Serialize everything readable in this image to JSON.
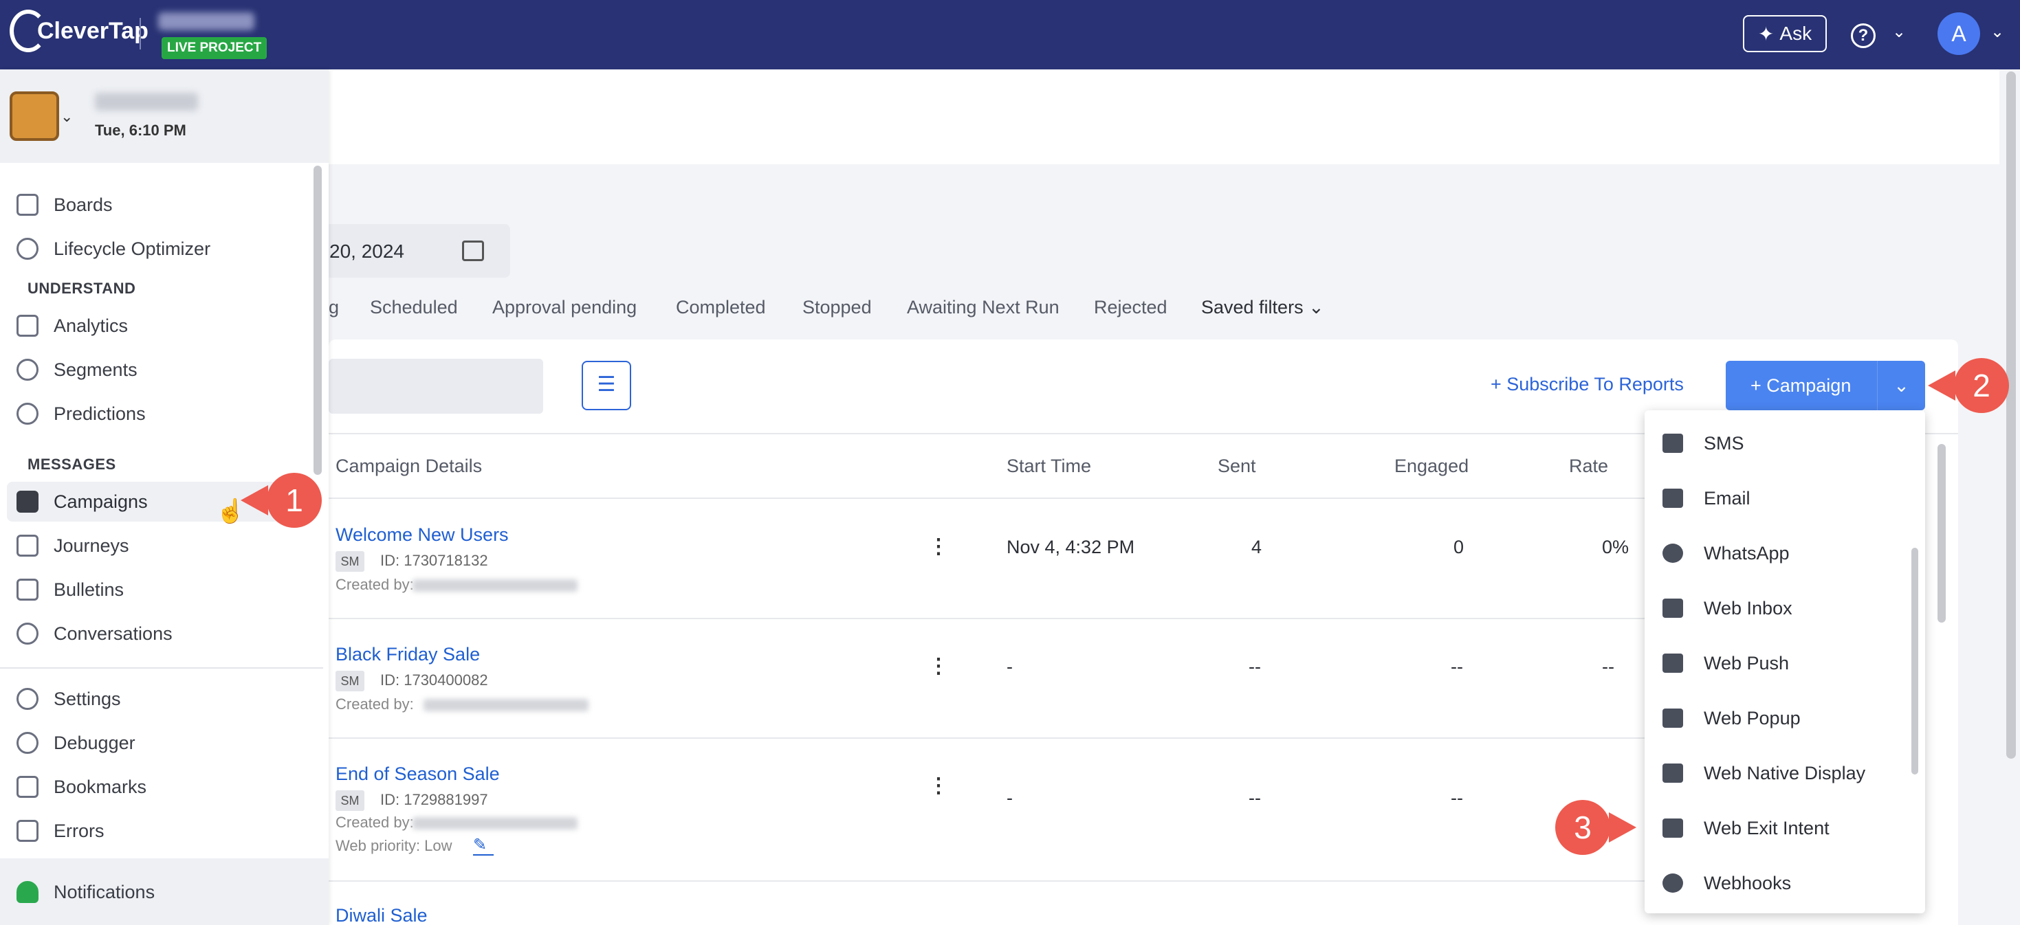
{
  "app": {
    "logo_text": "CleverTap",
    "live_badge": "LIVE PROJECT",
    "ask_label": "Ask",
    "avatar_initial": "A",
    "brand_color": "#283274",
    "accent_color": "#4a84f0"
  },
  "account": {
    "time": "Tue, 6:10 PM"
  },
  "sidebar": {
    "items_top": [
      {
        "label": "Boards",
        "icon": "boards-icon"
      },
      {
        "label": "Lifecycle Optimizer",
        "icon": "lifecycle-icon"
      }
    ],
    "understand_label": "UNDERSTAND",
    "understand_items": [
      {
        "label": "Analytics",
        "icon": "analytics-icon"
      },
      {
        "label": "Segments",
        "icon": "segments-icon"
      },
      {
        "label": "Predictions",
        "icon": "predictions-icon"
      }
    ],
    "messages_label": "MESSAGES",
    "messages_items": [
      {
        "label": "Campaigns",
        "icon": "campaigns-icon",
        "active": true
      },
      {
        "label": "Journeys",
        "icon": "journeys-icon"
      },
      {
        "label": "Bulletins",
        "icon": "bulletins-icon"
      },
      {
        "label": "Conversations",
        "icon": "conversations-icon"
      }
    ],
    "bottom_items": [
      {
        "label": "Settings",
        "icon": "settings-icon"
      },
      {
        "label": "Debugger",
        "icon": "debugger-icon"
      },
      {
        "label": "Bookmarks",
        "icon": "bookmarks-icon"
      },
      {
        "label": "Errors",
        "icon": "errors-icon"
      }
    ],
    "notifications_label": "Notifications"
  },
  "main": {
    "date_text": "20, 2024",
    "tabs": [
      "g",
      "Scheduled",
      "Approval pending",
      "Completed",
      "Stopped",
      "Awaiting Next Run",
      "Rejected",
      "Saved filters"
    ],
    "subscribe_label": "+ Subscribe To Reports",
    "campaign_button_label": "+ Campaign",
    "columns": [
      "Campaign Details",
      "Start Time",
      "Sent",
      "Engaged",
      "Rate"
    ],
    "rows": [
      {
        "name": "Welcome New Users",
        "badge": "SM",
        "id": "ID: 1730718132",
        "created": "Created by:",
        "start": "Nov 4, 4:32 PM",
        "sent": "4",
        "engaged": "0",
        "rate": "0%"
      },
      {
        "name": "Black Friday Sale",
        "badge": "SM",
        "id": "ID: 1730400082",
        "created": "Created by:",
        "start": "-",
        "sent": "--",
        "engaged": "--",
        "rate": "--"
      },
      {
        "name": "End of Season Sale",
        "badge": "SM",
        "id": "ID: 1729881997",
        "created": "Created by:",
        "priority": "Web priority: Low",
        "start": "-",
        "sent": "--",
        "engaged": "--",
        "rate": "--"
      },
      {
        "name": "Diwali Sale"
      }
    ]
  },
  "dropdown": {
    "items": [
      {
        "label": "SMS",
        "icon": "sms-icon"
      },
      {
        "label": "Email",
        "icon": "email-icon"
      },
      {
        "label": "WhatsApp",
        "icon": "whatsapp-icon"
      },
      {
        "label": "Web Inbox",
        "icon": "web-inbox-icon"
      },
      {
        "label": "Web Push",
        "icon": "web-push-icon"
      },
      {
        "label": "Web Popup",
        "icon": "web-popup-icon"
      },
      {
        "label": "Web Native Display",
        "icon": "web-native-display-icon"
      },
      {
        "label": "Web Exit Intent",
        "icon": "web-exit-intent-icon"
      },
      {
        "label": "Webhooks",
        "icon": "webhooks-icon"
      }
    ]
  },
  "callouts": [
    "1",
    "2",
    "3"
  ]
}
